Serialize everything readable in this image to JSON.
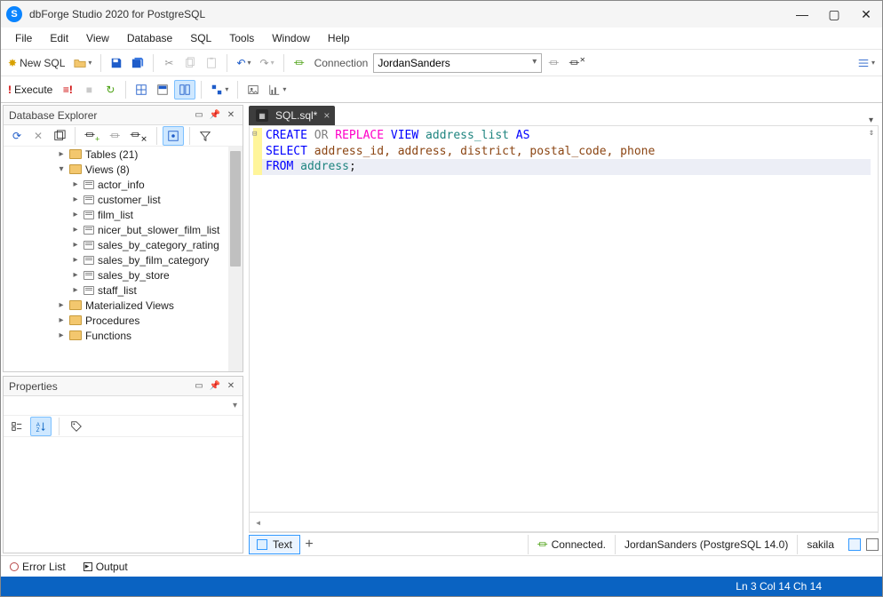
{
  "app": {
    "title": "dbForge Studio 2020 for PostgreSQL",
    "icon_letter": "S"
  },
  "menu": {
    "items": [
      "File",
      "Edit",
      "View",
      "Database",
      "SQL",
      "Tools",
      "Window",
      "Help"
    ]
  },
  "toolbar1": {
    "new_sql": "New SQL",
    "connection_label": "Connection",
    "connection_value": "JordanSanders"
  },
  "toolbar2": {
    "execute": "Execute"
  },
  "db_explorer": {
    "title": "Database Explorer",
    "tables_label": "Tables (21)",
    "views_label": "Views (8)",
    "views": [
      "actor_info",
      "customer_list",
      "film_list",
      "nicer_but_slower_film_list",
      "sales_by_category_rating",
      "sales_by_film_category",
      "sales_by_store",
      "staff_list"
    ],
    "more": [
      "Materialized Views",
      "Procedures",
      "Functions"
    ]
  },
  "properties": {
    "title": "Properties"
  },
  "editor": {
    "tab_label": "SQL.sql*",
    "code": {
      "l1": {
        "create": "CREATE",
        "or": "OR",
        "replace": "REPLACE",
        "view": "VIEW",
        "name": "address_list",
        "as": "AS"
      },
      "l2": {
        "select": "SELECT",
        "cols": "address_id, address, district, postal_code, phone"
      },
      "l3": {
        "from": "FROM",
        "tbl": "address",
        "semi": ";"
      }
    },
    "view_tab": "Text",
    "status_connected": "Connected.",
    "status_conn": "JordanSanders (PostgreSQL 14.0)",
    "status_db": "sakila"
  },
  "bottom": {
    "error_list": "Error List",
    "output": "Output"
  },
  "statusbar": {
    "pos": "Ln 3    Col 14    Ch 14"
  }
}
